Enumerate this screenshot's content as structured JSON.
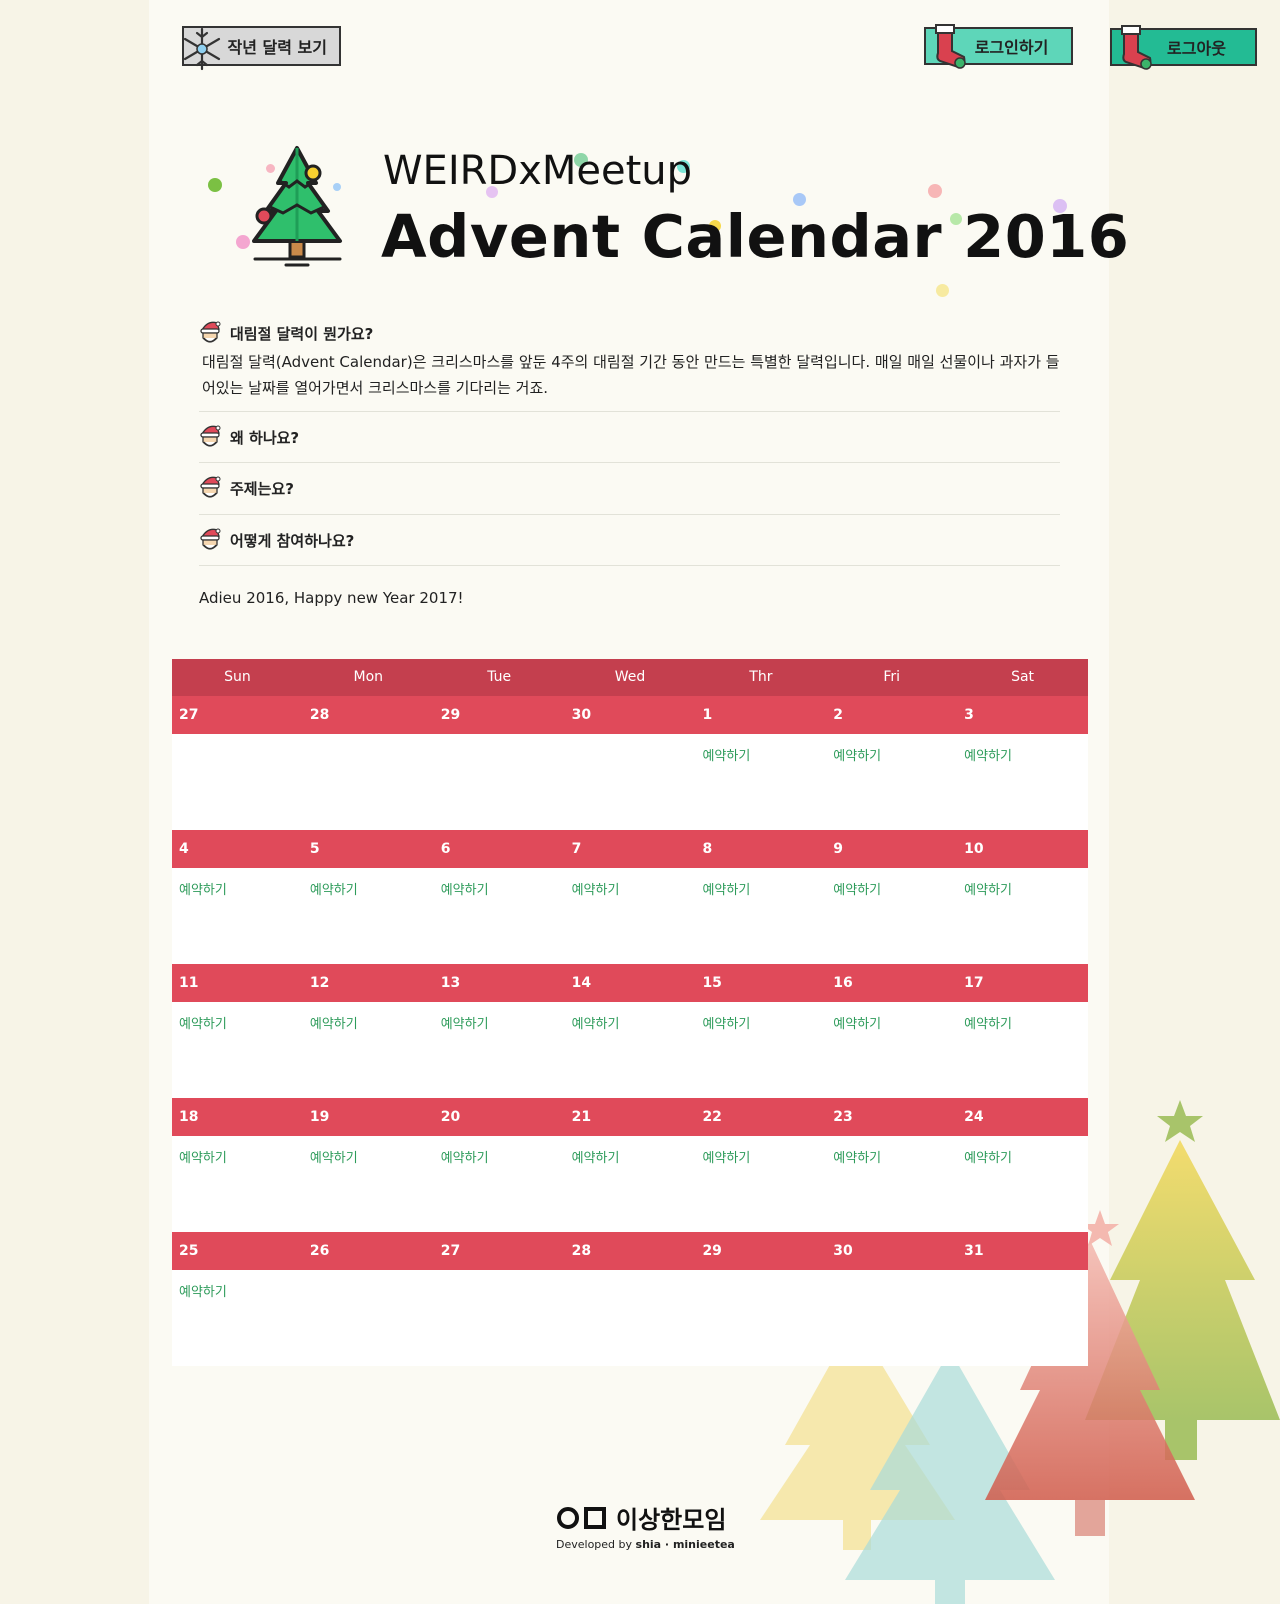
{
  "top_buttons": {
    "last_year": "작년 달력 보기",
    "login": "로그인하기",
    "logout": "로그아웃"
  },
  "header": {
    "subtitle": "WEIRDxMeetup",
    "title": "Advent Calendar 2016"
  },
  "faq": [
    {
      "question": "대림절 달력이 뭔가요?",
      "answer": "대림절 달력(Advent Calendar)은 크리스마스를 앞둔 4주의 대림절 기간 동안 만드는 특별한 달력입니다. 매일 매일 선물이나 과자가 들어있는 날짜를 열어가면서 크리스마스를 기다리는 거죠."
    },
    {
      "question": "왜 하나요?"
    },
    {
      "question": "주제는요?"
    },
    {
      "question": "어떻게 참여하나요?"
    }
  ],
  "farewell": "Adieu 2016, Happy new Year 2017!",
  "calendar": {
    "weekdays": [
      "Sun",
      "Mon",
      "Tue",
      "Wed",
      "Thr",
      "Fri",
      "Sat"
    ],
    "reserve_label": "예약하기",
    "weeks": [
      {
        "days": [
          "27",
          "28",
          "29",
          "30",
          "1",
          "2",
          "3"
        ],
        "reserve": [
          "",
          "",
          "",
          "",
          "예약하기",
          "예약하기",
          "예약하기"
        ]
      },
      {
        "days": [
          "4",
          "5",
          "6",
          "7",
          "8",
          "9",
          "10"
        ],
        "reserve": [
          "예약하기",
          "예약하기",
          "예약하기",
          "예약하기",
          "예약하기",
          "예약하기",
          "예약하기"
        ]
      },
      {
        "days": [
          "11",
          "12",
          "13",
          "14",
          "15",
          "16",
          "17"
        ],
        "reserve": [
          "예약하기",
          "예약하기",
          "예약하기",
          "예약하기",
          "예약하기",
          "예약하기",
          "예약하기"
        ]
      },
      {
        "days": [
          "18",
          "19",
          "20",
          "21",
          "22",
          "23",
          "24"
        ],
        "reserve": [
          "예약하기",
          "예약하기",
          "예약하기",
          "예약하기",
          "예약하기",
          "예약하기",
          "예약하기"
        ]
      },
      {
        "days": [
          "25",
          "26",
          "27",
          "28",
          "29",
          "30",
          "31"
        ],
        "reserve": [
          "예약하기",
          "",
          "",
          "",
          "",
          "",
          ""
        ]
      }
    ]
  },
  "footer": {
    "logo_text": "이상한모임",
    "credit_prefix": "Developed by ",
    "credit_names": "shia · minieetea"
  },
  "icons": {
    "last_year": "snowflake-icon",
    "login": "stocking-icon",
    "logout": "stocking-icon",
    "faq": "santa-icon",
    "logo": "christmas-tree-icon"
  },
  "colors": {
    "weekday_header": "#c43f4e",
    "date_row": "#e04a5a",
    "reserve_link": "#2d9b5a",
    "login_button": "#5ed6b9",
    "logout_button": "#23bb94"
  }
}
